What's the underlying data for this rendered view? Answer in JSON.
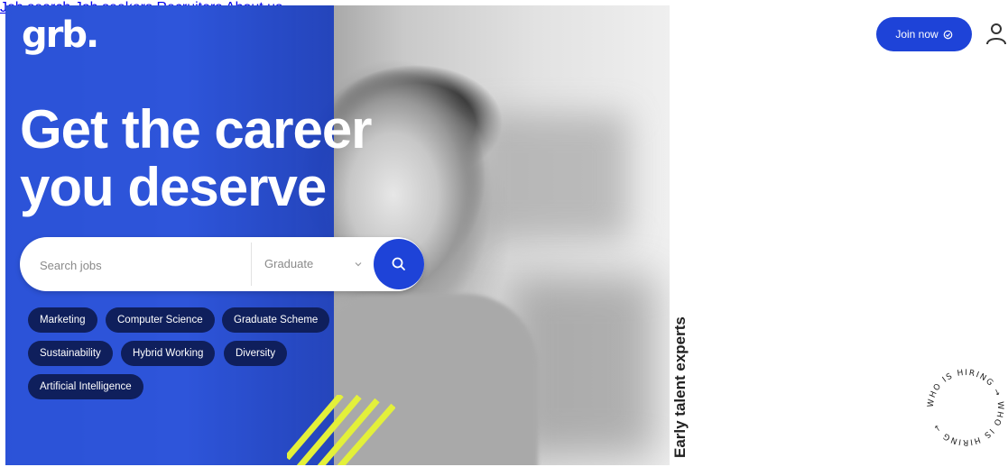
{
  "brand": {
    "logo_text": "grb."
  },
  "nav": {
    "items": [
      {
        "label": "Job search"
      },
      {
        "label": "Job seekers"
      },
      {
        "label": "Recruiters"
      },
      {
        "label": "About us"
      }
    ],
    "join_label": "Join now"
  },
  "hero": {
    "headline_line1": "Get the career",
    "headline_line2": "you deserve"
  },
  "search": {
    "placeholder": "Search jobs",
    "level_selected": "Graduate"
  },
  "chips": [
    {
      "label": "Marketing"
    },
    {
      "label": "Computer Science"
    },
    {
      "label": "Graduate Scheme"
    },
    {
      "label": "Sustainability"
    },
    {
      "label": "Hybrid Working"
    },
    {
      "label": "Diversity"
    },
    {
      "label": "Artificial Intelligence"
    }
  ],
  "tagline": "Early talent experts",
  "badge": {
    "text": "WHO IS HIRING → WHO IS HIRING →"
  },
  "colors": {
    "brand_blue": "#1e43d8",
    "chip_navy": "#0f1f5c",
    "accent_yellow": "#e3f03a"
  }
}
